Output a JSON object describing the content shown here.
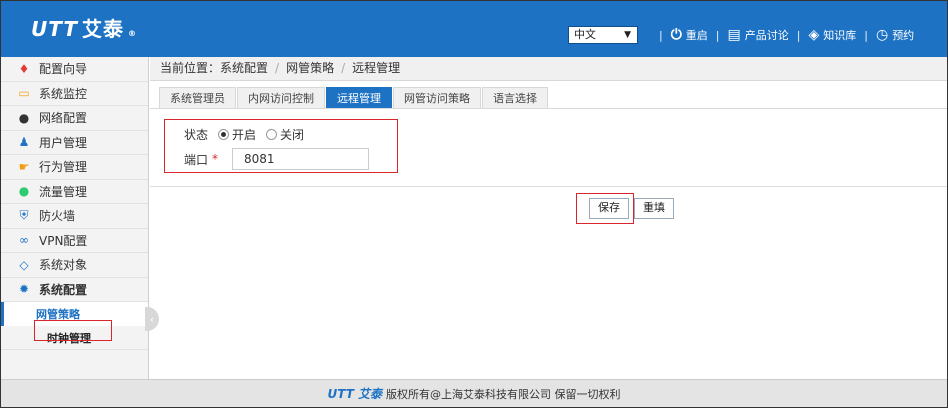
{
  "header": {
    "logo_mark": "UTT",
    "logo_text": "艾泰",
    "lang_select": "中文",
    "nav": [
      {
        "label": "重启",
        "icon": "power-icon"
      },
      {
        "label": "产品讨论",
        "icon": "chat-icon"
      },
      {
        "label": "知识库",
        "icon": "stack-icon"
      },
      {
        "label": "预约",
        "icon": "clock-icon"
      }
    ]
  },
  "sidebar": {
    "items": [
      {
        "label": "配置向导",
        "icon": "pin-icon",
        "color": "#e53935"
      },
      {
        "label": "系统监控",
        "icon": "monitor-icon",
        "color": "#f4a321"
      },
      {
        "label": "网络配置",
        "icon": "globe-icon",
        "color": "#333333"
      },
      {
        "label": "用户管理",
        "icon": "users-icon",
        "color": "#1d72c4"
      },
      {
        "label": "行为管理",
        "icon": "hand-icon",
        "color": "#f39c12"
      },
      {
        "label": "流量管理",
        "icon": "flow-icon",
        "color": "#2ecc71"
      },
      {
        "label": "防火墙",
        "icon": "shield-icon",
        "color": "#1d72c4"
      },
      {
        "label": "VPN配置",
        "icon": "link-icon",
        "color": "#1d72c4"
      },
      {
        "label": "系统对象",
        "icon": "cube-icon",
        "color": "#1d72c4"
      },
      {
        "label": "系统配置",
        "icon": "gear-icon",
        "color": "#1d72c4"
      }
    ],
    "sub_items": [
      "网管策略",
      "时钟管理"
    ]
  },
  "breadcrumb": {
    "prefix": "当前位置：",
    "path": [
      "系统配置",
      "网管策略",
      "远程管理"
    ]
  },
  "tabs": [
    "系统管理员",
    "内网访问控制",
    "远程管理",
    "网管访问策略",
    "语言选择"
  ],
  "form": {
    "status_label": "状态",
    "status_on": "开启",
    "status_off": "关闭",
    "port_label": "端口",
    "port_required": "*",
    "port_value": "8081"
  },
  "buttons": {
    "save": "保存",
    "reset": "重填"
  },
  "footer": {
    "logo_mark": "UTT",
    "logo_text": "艾泰",
    "copyright": "版权所有@上海艾泰科技有限公司 保留一切权利"
  }
}
